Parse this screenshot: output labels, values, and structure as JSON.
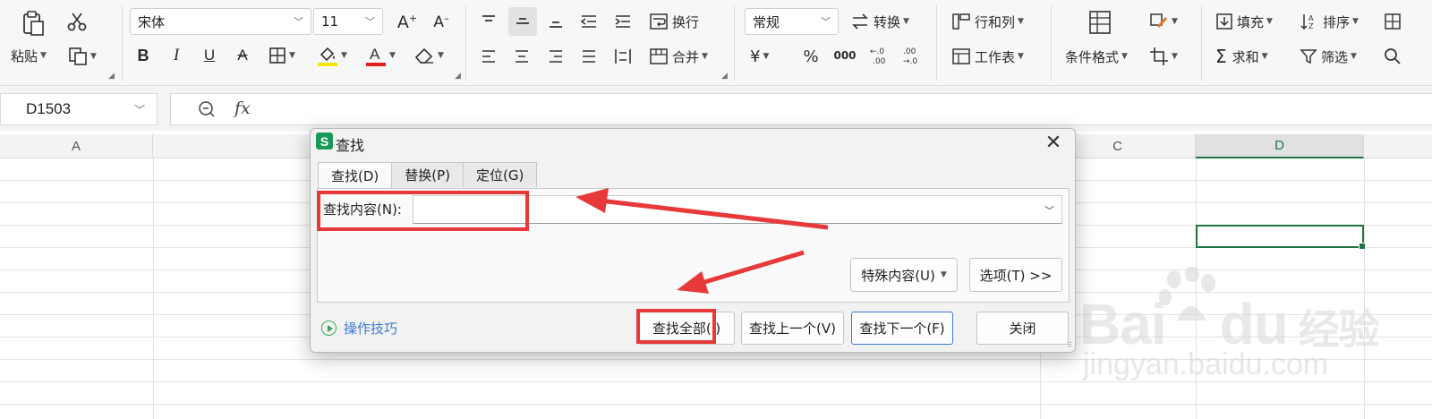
{
  "ribbon": {
    "clipboard": {
      "paste_label": "粘贴",
      "cut_icon": "scissors-icon",
      "copy_icon": "copy-icon"
    },
    "font": {
      "name": "宋体",
      "size": "11",
      "increase_icon": "font-size-increase-icon",
      "decrease_icon": "font-size-decrease-icon",
      "bold": "B",
      "italic": "I",
      "underline": "U",
      "strike": "A",
      "fill_color": "#f5e50a",
      "font_color": "#e02020"
    },
    "alignment": {
      "wrap_label": "换行",
      "merge_label": "合并"
    },
    "number": {
      "format": "常规",
      "convert_label": "转换",
      "currency": "¥",
      "percent": "%",
      "thousands": "000"
    },
    "cells": {
      "rowcol_label": "行和列",
      "sheet_label": "工作表"
    },
    "styles": {
      "cond_format_label": "条件格式"
    },
    "editing": {
      "fill_label": "填充",
      "sort_label": "排序",
      "sum_label": "求和",
      "filter_label": "筛选"
    }
  },
  "formula_bar": {
    "name_box": "D1503",
    "fx_label": "fx",
    "formula": ""
  },
  "grid": {
    "columns": [
      "A",
      "C",
      "D"
    ],
    "selected_column": "D",
    "accent": "#217346"
  },
  "dialog": {
    "title": "查找",
    "app_icon_letter": "S",
    "close_glyph": "✕",
    "tabs": [
      "查找(D)",
      "替换(P)",
      "定位(G)"
    ],
    "find_label": "查找内容(N):",
    "find_value": "",
    "special_button": "特殊内容(U)",
    "options_button": "选项(T) >>",
    "tips_link": "操作技巧",
    "find_all_button": "查找全部(I)",
    "find_prev_button": "查找上一个(V)",
    "find_next_button": "查找下一个(F)",
    "close_button": "关闭"
  },
  "annotations": {
    "color": "#e8393a"
  },
  "watermark": {
    "brand": "Bai",
    "brand2": "du",
    "product": "经验",
    "url": "jingyan.baidu.com"
  }
}
